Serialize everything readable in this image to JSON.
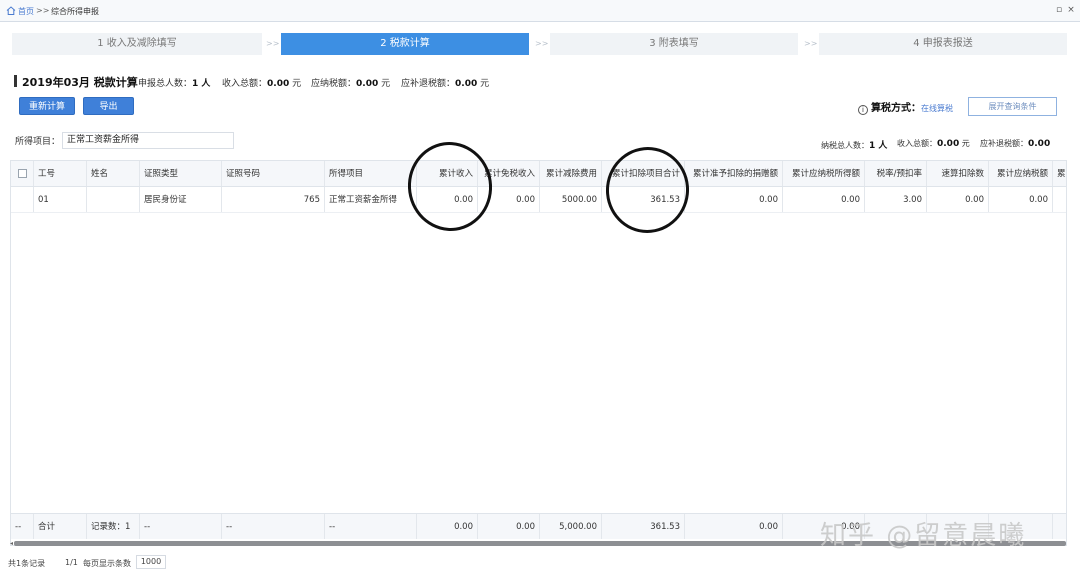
{
  "breadcrumb": {
    "home": "首页",
    "separator": ">>",
    "current": "综合所得申报"
  },
  "window_buttons": {
    "restore": "▫",
    "close": "×"
  },
  "steps": [
    {
      "label": "1 收入及减除填写",
      "active": false
    },
    {
      "label": "2 税款计算",
      "active": true
    },
    {
      "label": "3 附表填写",
      "active": false
    },
    {
      "label": "4 申报表报送",
      "active": false
    }
  ],
  "step_separator": ">>",
  "summary": {
    "title": "2019年03月 税款计算",
    "declare_count_label": "申报总人数：",
    "declare_count_value": "1 人",
    "income_total_label": "收入总额：",
    "income_total_value": "0.00",
    "income_total_unit": "元",
    "tax_payable_label": "应纳税额：",
    "tax_payable_value": "0.00",
    "tax_payable_unit": "元",
    "refund_label": "应补退税额：",
    "refund_value": "0.00",
    "refund_unit": "元"
  },
  "buttons": {
    "recalculate": "重新计算",
    "export": "导出",
    "expand_query": "展开查询条件"
  },
  "calc_method": {
    "icon": "i",
    "label": "算税方式：",
    "value": "在线算税"
  },
  "filter": {
    "label": "所得项目：",
    "value": "正常工资薪金所得"
  },
  "right_summary": {
    "taxpayer_count_label": "纳税总人数：",
    "taxpayer_count_value": "1 人",
    "income_total_label": "收入总额：",
    "income_total_value": "0.00",
    "income_total_unit": "元",
    "refund_label": "应补退税额：",
    "refund_value": "0.00",
    "refund_unit": "元"
  },
  "table": {
    "columns": [
      "",
      "工号",
      "姓名",
      "证照类型",
      "证照号码",
      "所得项目",
      "累计收入",
      "累计免税收入",
      "累计减除费用",
      "累计扣除项目合计",
      "累计准予扣除的捐赠额",
      "累计应纳税所得额",
      "税率/预扣率",
      "速算扣除数",
      "累计应纳税额",
      "累"
    ],
    "rows": [
      [
        "",
        "01",
        "",
        "居民身份证",
        "765",
        "正常工资薪金所得",
        "0.00",
        "0.00",
        "5000.00",
        "361.53",
        "0.00",
        "0.00",
        "3.00",
        "0.00",
        "0.00",
        ""
      ]
    ],
    "footer": [
      "--",
      "合计",
      "记录数：1",
      "--",
      "--",
      "--",
      "0.00",
      "0.00",
      "5,000.00",
      "361.53",
      "0.00",
      "0.00",
      "",
      "",
      "",
      ""
    ]
  },
  "pager": {
    "total_records": "共1条记录",
    "page": "1/1",
    "page_size_label": "每页显示条数",
    "page_size": "1000"
  },
  "watermark": "知乎 @留意晨曦"
}
